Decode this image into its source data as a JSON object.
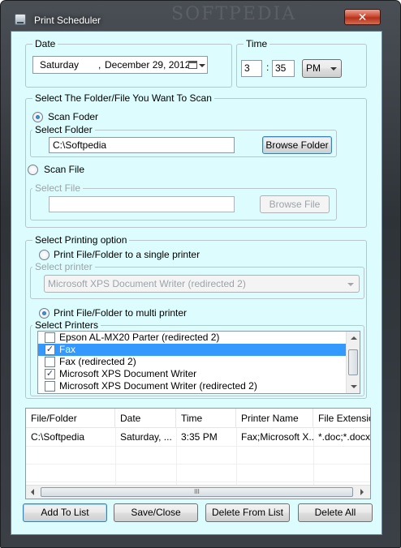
{
  "window": {
    "title": "Print Scheduler",
    "close_glyph": "✕",
    "watermark": "SOFTPEDIA"
  },
  "date": {
    "group_label": "Date",
    "weekday": "Saturday",
    "value": "December 29, 2012",
    "comma": ","
  },
  "time": {
    "group_label": "Time",
    "hour": "3",
    "separator": ":",
    "minute": "35",
    "ampm": "PM"
  },
  "scan": {
    "group_label": "Select The Folder/File You Want To Scan",
    "folder_option": "Scan Foder",
    "folder_option_selected": true,
    "folder_group_label": "Select Folder",
    "folder_value": "C:\\Softpedia",
    "browse_folder_label": "Browse Folder",
    "file_option": "Scan File",
    "file_group_label": "Select File",
    "file_value": "",
    "browse_file_label": "Browse File"
  },
  "printing": {
    "group_label": "Select Printing option",
    "single_option": "Print File/Folder to a single printer",
    "printer_group_label": "Select printer",
    "single_printer_value": "Microsoft XPS Document Writer (redirected 2)",
    "multi_option": "Print File/Folder to multi printer",
    "multi_selected": true,
    "printers_group_label": "Select Printers",
    "printers": [
      {
        "name": "Epson AL-MX20 Parter (redirected 2)",
        "checked": false,
        "selected": false
      },
      {
        "name": "Fax",
        "checked": true,
        "selected": true
      },
      {
        "name": "Fax (redirected 2)",
        "checked": false,
        "selected": false
      },
      {
        "name": "Microsoft XPS Document Writer",
        "checked": true,
        "selected": false
      },
      {
        "name": "Microsoft XPS Document Writer (redirected 2)",
        "checked": false,
        "selected": false
      }
    ]
  },
  "schedule": {
    "columns": [
      "File/Folder",
      "Date",
      "Time",
      "Printer Name",
      "File Extensio..."
    ],
    "rows": [
      [
        "C:\\Softpedia",
        "Saturday, ...",
        "3:35 PM",
        "Fax;Microsoft X...",
        "*.doc;*.docx..."
      ]
    ],
    "scroll_grip": "III"
  },
  "actions": {
    "add": "Add To List",
    "save": "Save/Close",
    "delete": "Delete From List",
    "delete_all": "Delete All"
  },
  "check_glyph": "✓"
}
